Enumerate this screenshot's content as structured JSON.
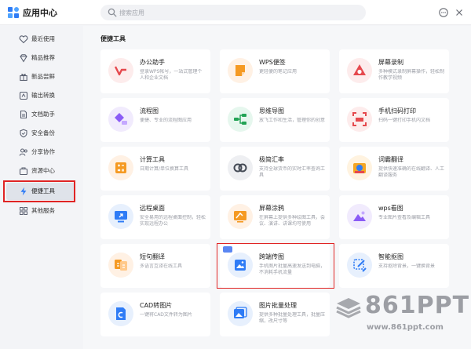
{
  "app": {
    "title": "应用中心"
  },
  "search": {
    "placeholder": "搜索应用",
    "value": ""
  },
  "sidebar": {
    "items": [
      {
        "label": "最近使用",
        "icon": "heart-icon"
      },
      {
        "label": "精品推荐",
        "icon": "diamond-icon"
      },
      {
        "label": "新品尝鲜",
        "icon": "gift-icon"
      },
      {
        "label": "输出转换",
        "icon": "convert-icon"
      },
      {
        "label": "文档助手",
        "icon": "document-icon"
      },
      {
        "label": "安全备份",
        "icon": "shield-icon"
      },
      {
        "label": "分享协作",
        "icon": "share-icon"
      },
      {
        "label": "资源中心",
        "icon": "cube-icon"
      },
      {
        "label": "便捷工具",
        "icon": "lightning-icon"
      },
      {
        "label": "其他服务",
        "icon": "grid-icon"
      }
    ],
    "active_index": 8
  },
  "main": {
    "section_title": "便捷工具",
    "cards": [
      {
        "title": "办公助手",
        "desc": "登录WPS帐号，一站式管理个人和企业文档",
        "icon": "office-assistant-icon",
        "bg": "#fdecec",
        "color": "#e5484d"
      },
      {
        "title": "WPS便签",
        "desc": "更轻便的笔记应用",
        "icon": "note-icon",
        "bg": "#fff1e4",
        "color": "#f59a23"
      },
      {
        "title": "屏幕录制",
        "desc": "多种模式录制屏幕操作，轻松制作教学视频",
        "icon": "screen-record-icon",
        "bg": "#fdecec",
        "color": "#e5484d"
      },
      {
        "title": "流程图",
        "desc": "便捷、专业的流程图应用",
        "icon": "flowchart-icon",
        "bg": "#f1ebfd",
        "color": "#8b5cf6"
      },
      {
        "title": "思维导图",
        "desc": "放飞工作和生活，管理你的创意",
        "icon": "mindmap-icon",
        "bg": "#e6f7ee",
        "color": "#22a355"
      },
      {
        "title": "手机扫码打印",
        "desc": "扫码一键打印手机内文档",
        "icon": "scan-print-icon",
        "bg": "#fdecec",
        "color": "#e5484d"
      },
      {
        "title": "计算工具",
        "desc": "日期计算/单位换算工具",
        "icon": "calculator-icon",
        "bg": "#fff1e4",
        "color": "#f59a23"
      },
      {
        "title": "极简汇率",
        "desc": "支持全球货币的实时汇率查询工具",
        "icon": "exchange-icon",
        "bg": "#eeeff2",
        "color": "#444a55"
      },
      {
        "title": "词霸翻译",
        "desc": "提供快速准确的在线翻译、人工翻译服务",
        "icon": "translate-icon",
        "bg": "#fff3e0",
        "color": "#f5a623"
      },
      {
        "title": "远程桌面",
        "desc": "安全易用的远程桌面控制，轻松实现远程办公",
        "icon": "remote-desktop-icon",
        "bg": "#e7f0fd",
        "color": "#2f7cf6"
      },
      {
        "title": "屏幕涂鸦",
        "desc": "在屏幕上提供多种绘图工具，会议、演讲、讲课均可使用",
        "icon": "doodle-icon",
        "bg": "#fff1e4",
        "color": "#f59a23"
      },
      {
        "title": "wps看图",
        "desc": "专业图片查看及编辑工具",
        "icon": "photo-viewer-icon",
        "bg": "#f1ebfd",
        "color": "#8b5cf6"
      },
      {
        "title": "短句翻译",
        "desc": "多语言互译在线工具",
        "icon": "phrase-translate-icon",
        "bg": "#fff1e4",
        "color": "#f59a23"
      },
      {
        "title": "跨端传图",
        "desc": "手机图片批量高速发送到电脑，不消耗手机流量",
        "icon": "transfer-image-icon",
        "bg": "#e7f0fd",
        "color": "#2f7cf6"
      },
      {
        "title": "智能抠图",
        "desc": "支持抠除背景，一键换背景",
        "icon": "smart-cutout-icon",
        "bg": "#e7f0fd",
        "color": "#2f7cf6"
      },
      {
        "title": "CAD转图片",
        "desc": "一键将CAD文件转为图片",
        "icon": "cad-icon",
        "bg": "#e7f0fd",
        "color": "#2f7cf6"
      },
      {
        "title": "图片批量处理",
        "desc": "提供多种批量处理工具，批量压缩，改尺寸等",
        "icon": "batch-image-icon",
        "bg": "#e7f0fd",
        "color": "#2f7cf6"
      }
    ]
  },
  "watermark": {
    "brand": "861PPT",
    "url": "www.861ppt.com"
  }
}
